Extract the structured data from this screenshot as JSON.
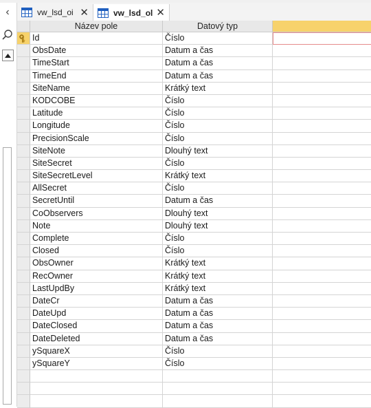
{
  "tabs": [
    {
      "label": "vw_lsd_oi",
      "active": false
    },
    {
      "label": "vw_lsd_ol",
      "active": true
    }
  ],
  "grid": {
    "headers": {
      "field_name": "Název pole",
      "data_type": "Datový typ",
      "description": ""
    },
    "rows": [
      {
        "name": "Id",
        "type": "Číslo",
        "primary_key": true
      },
      {
        "name": "ObsDate",
        "type": "Datum a čas"
      },
      {
        "name": "TimeStart",
        "type": "Datum a čas"
      },
      {
        "name": "TimeEnd",
        "type": "Datum a čas"
      },
      {
        "name": "SiteName",
        "type": "Krátký text"
      },
      {
        "name": "KODCOBE",
        "type": "Číslo"
      },
      {
        "name": "Latitude",
        "type": "Číslo"
      },
      {
        "name": "Longitude",
        "type": "Číslo"
      },
      {
        "name": "PrecisionScale",
        "type": "Číslo"
      },
      {
        "name": "SiteNote",
        "type": "Dlouhý text"
      },
      {
        "name": "SiteSecret",
        "type": "Číslo"
      },
      {
        "name": "SiteSecretLevel",
        "type": "Krátký text"
      },
      {
        "name": "AllSecret",
        "type": "Číslo"
      },
      {
        "name": "SecretUntil",
        "type": "Datum a čas"
      },
      {
        "name": "CoObservers",
        "type": "Dlouhý text"
      },
      {
        "name": "Note",
        "type": "Dlouhý text"
      },
      {
        "name": "Complete",
        "type": "Číslo"
      },
      {
        "name": "Closed",
        "type": "Číslo"
      },
      {
        "name": "ObsOwner",
        "type": "Krátký text"
      },
      {
        "name": "RecOwner",
        "type": "Krátký text"
      },
      {
        "name": "LastUpdBy",
        "type": "Krátký text"
      },
      {
        "name": "DateCr",
        "type": "Datum a čas"
      },
      {
        "name": "DateUpd",
        "type": "Datum a čas"
      },
      {
        "name": "DateClosed",
        "type": "Datum a čas"
      },
      {
        "name": "DateDeleted",
        "type": "Datum a čas"
      },
      {
        "name": "ySquareX",
        "type": "Číslo"
      },
      {
        "name": "ySquareY",
        "type": "Číslo"
      },
      {
        "name": "",
        "type": ""
      },
      {
        "name": "",
        "type": ""
      },
      {
        "name": "",
        "type": ""
      }
    ]
  },
  "colors": {
    "accent": "#f7d26b",
    "focus_border": "#e58a8a",
    "tab_icon": "#1f5fbf"
  },
  "icons": {
    "collapse": "chevron-left-icon",
    "search": "search-icon",
    "scroll_up": "scroll-up-icon",
    "primary_key": "key-icon",
    "table": "table-icon",
    "close": "close-icon"
  }
}
